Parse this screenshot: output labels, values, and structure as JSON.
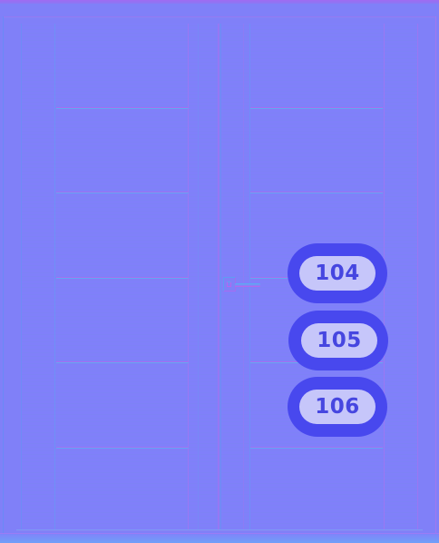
{
  "scene": {
    "description_colors": {
      "background": "#8080f8",
      "badge_ring": "#4848ee",
      "badge_fill": "#c6c6fa",
      "badge_text": "#4646e0"
    },
    "room_numbers": [
      {
        "label": "104"
      },
      {
        "label": "105"
      },
      {
        "label": "106"
      }
    ]
  }
}
